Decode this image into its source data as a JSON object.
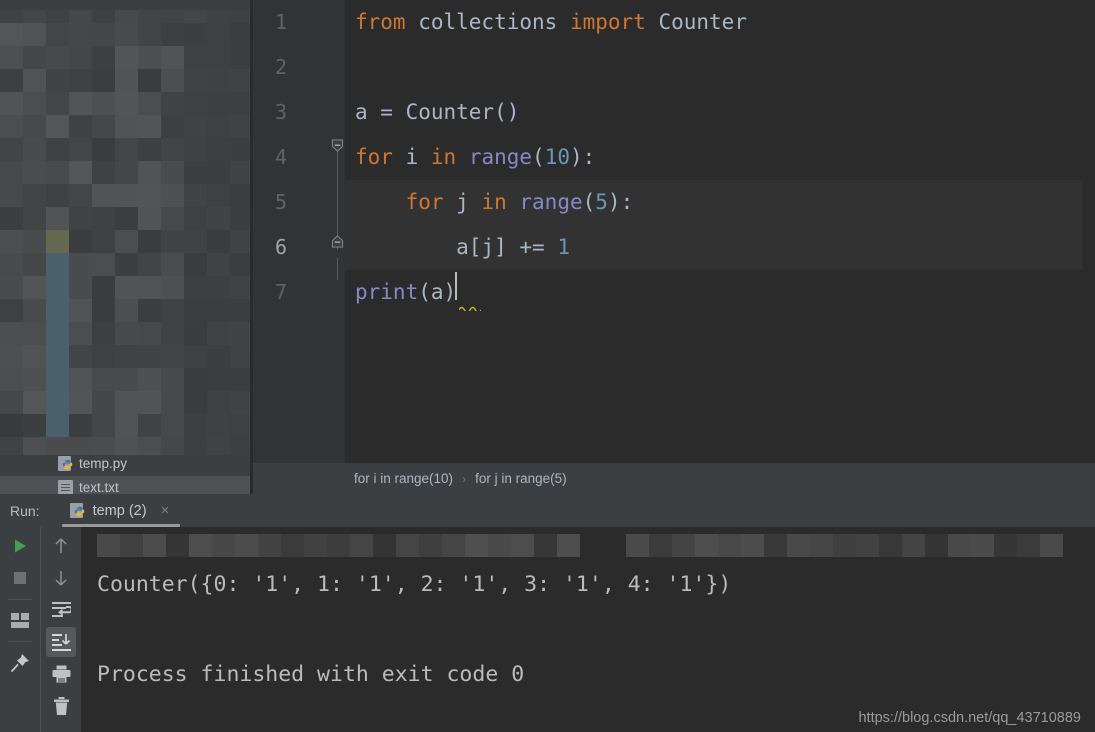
{
  "editor": {
    "line_numbers": [
      "1",
      "2",
      "3",
      "4",
      "5",
      "6",
      "7"
    ],
    "lines": [
      {
        "num": "1",
        "text": "from collections import Counter"
      },
      {
        "num": "2",
        "text": ""
      },
      {
        "num": "3",
        "text": "a = Counter()"
      },
      {
        "num": "4",
        "text": "for i in range(10):"
      },
      {
        "num": "5",
        "text": "    for j in range(5):"
      },
      {
        "num": "6",
        "text": "        a[j] += 1"
      },
      {
        "num": "7",
        "text": "print(a)"
      }
    ],
    "tokens": {
      "kw_from": "from",
      "mod_collections": " collections",
      "kw_import": " import",
      "name_counter": " Counter",
      "var_a": "a = ",
      "call_counter": "Counter()",
      "kw_for": "for",
      "var_i": " i ",
      "kw_in": "in",
      "fn_range": " range",
      "paren_open": "(",
      "num_10": "10",
      "paren_close_colon": "):",
      "indent4": "    ",
      "var_j": " j ",
      "num_5": "5",
      "indent8": "        ",
      "expr_aj": "a[j] ",
      "op_plus_eq": "+= ",
      "num_1": "1",
      "fn_print": "print",
      "print_arg": "(a)"
    },
    "breadcrumb": {
      "first": "for i in range(10)",
      "separator": "›",
      "second": "for j in range(5)"
    },
    "fold_markers": [
      "−",
      "−"
    ]
  },
  "project": {
    "files": [
      {
        "name": "temp.py",
        "icon": "python-file-icon",
        "selected": false
      },
      {
        "name": "text.txt",
        "icon": "text-file-icon",
        "selected": true
      }
    ]
  },
  "run_window": {
    "label": "Run:",
    "tab": {
      "icon": "python-file-icon",
      "title": "temp (2)",
      "close": "×"
    },
    "toolbar_left": [
      {
        "name": "rerun-button",
        "icon": "run-green-triangle-icon"
      },
      {
        "name": "stop-button",
        "icon": "stop-square-icon"
      },
      {
        "name": "layout-settings-button",
        "icon": "layout-icon"
      },
      {
        "name": "pin-tab-button",
        "icon": "pin-icon"
      }
    ],
    "toolbar_right": [
      {
        "name": "up-the-stack-button",
        "icon": "arrow-up-icon"
      },
      {
        "name": "down-the-stack-button",
        "icon": "arrow-down-icon"
      },
      {
        "name": "soft-wrap-button",
        "icon": "soft-wrap-icon"
      },
      {
        "name": "scroll-to-end-button",
        "icon": "scroll-to-end-icon",
        "active": true
      },
      {
        "name": "print-button",
        "icon": "printer-icon"
      },
      {
        "name": "clear-all-button",
        "icon": "trash-icon"
      }
    ],
    "console": {
      "command_line_censored": true,
      "output": "Counter({0: '1', 1: '1', 2: '1', 3: '1', 4: '1'})",
      "exit_message": "Process finished with exit code 0"
    }
  },
  "watermark": "https://blog.csdn.net/qq_43710889",
  "colors": {
    "editor_bg": "#2b2b2b",
    "panel_bg": "#3c3f41",
    "gutter_bg": "#313335",
    "keyword": "#cc7832",
    "builtin": "#8888c6",
    "number": "#6897bb",
    "text": "#a9b7c6",
    "line_number": "#606366",
    "current_line_bg": "#323232",
    "run_green": "#499c54"
  }
}
